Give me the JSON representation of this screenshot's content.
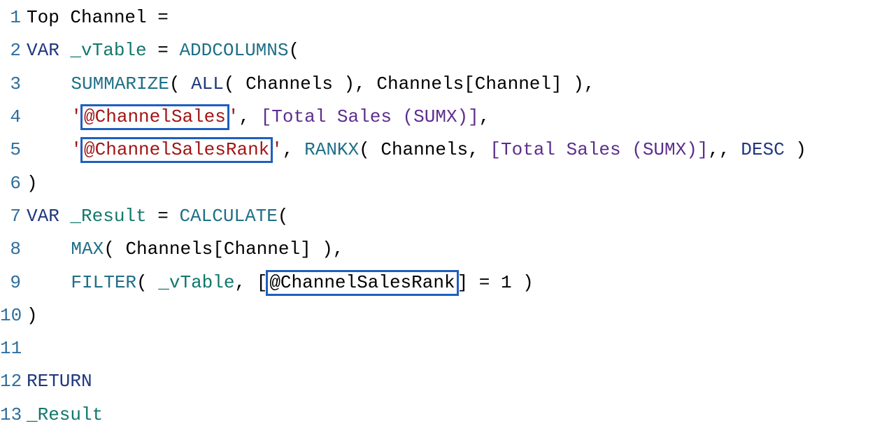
{
  "lines": {
    "n1": "1",
    "n2": "2",
    "n3": "3",
    "n4": "4",
    "n5": "5",
    "n6": "6",
    "n7": "7",
    "n8": "8",
    "n9": "9",
    "n10": "10",
    "n11": "11",
    "n12": "12",
    "n13": "13"
  },
  "tok": {
    "l1_a": "Top Channel ",
    "l1_eq": "=",
    "l2_var": "VAR",
    "l2_name": "_vTable",
    "l2_eq": " = ",
    "l2_fn": "ADDCOLUMNS",
    "l2_op": "(",
    "l3_fn": "SUMMARIZE",
    "l3_op1": "( ",
    "l3_all": "ALL",
    "l3_op2": "( ",
    "l3_tbl": "Channels",
    "l3_op3": " ), ",
    "l3_col": "Channels[Channel]",
    "l3_op4": " ),",
    "l4_q1": "'",
    "l4_str": "@ChannelSales",
    "l4_q2": "'",
    "l4_comma": ", ",
    "l4_meas": "[Total Sales (SUMX)]",
    "l4_end": ",",
    "l5_q1": "'",
    "l5_str": "@ChannelSalesRank",
    "l5_q2": "'",
    "l5_comma": ", ",
    "l5_fn": "RANKX",
    "l5_op1": "( ",
    "l5_tbl": "Channels",
    "l5_sep": ", ",
    "l5_meas": "[Total Sales (SUMX)]",
    "l5_tail": ",, ",
    "l5_desc": "DESC",
    "l5_cl": " )",
    "l6_cl": ")",
    "l7_var": "VAR",
    "l7_name": "_Result",
    "l7_eq": " = ",
    "l7_fn": "CALCULATE",
    "l7_op": "(",
    "l8_fn": "MAX",
    "l8_op1": "( ",
    "l8_col": "Channels[Channel]",
    "l8_cl": " ),",
    "l9_fn": "FILTER",
    "l9_op1": "( ",
    "l9_var": "_vTable",
    "l9_sep": ", ",
    "l9_lb": "[",
    "l9_ref": "@ChannelSalesRank",
    "l9_rb": "]",
    "l9_tail": " = 1 )",
    "l10_cl": ")",
    "l12_ret": "RETURN",
    "l13_res": "_Result"
  },
  "highlights": [
    "@ChannelSales",
    "@ChannelSalesRank",
    "@ChannelSalesRank"
  ]
}
